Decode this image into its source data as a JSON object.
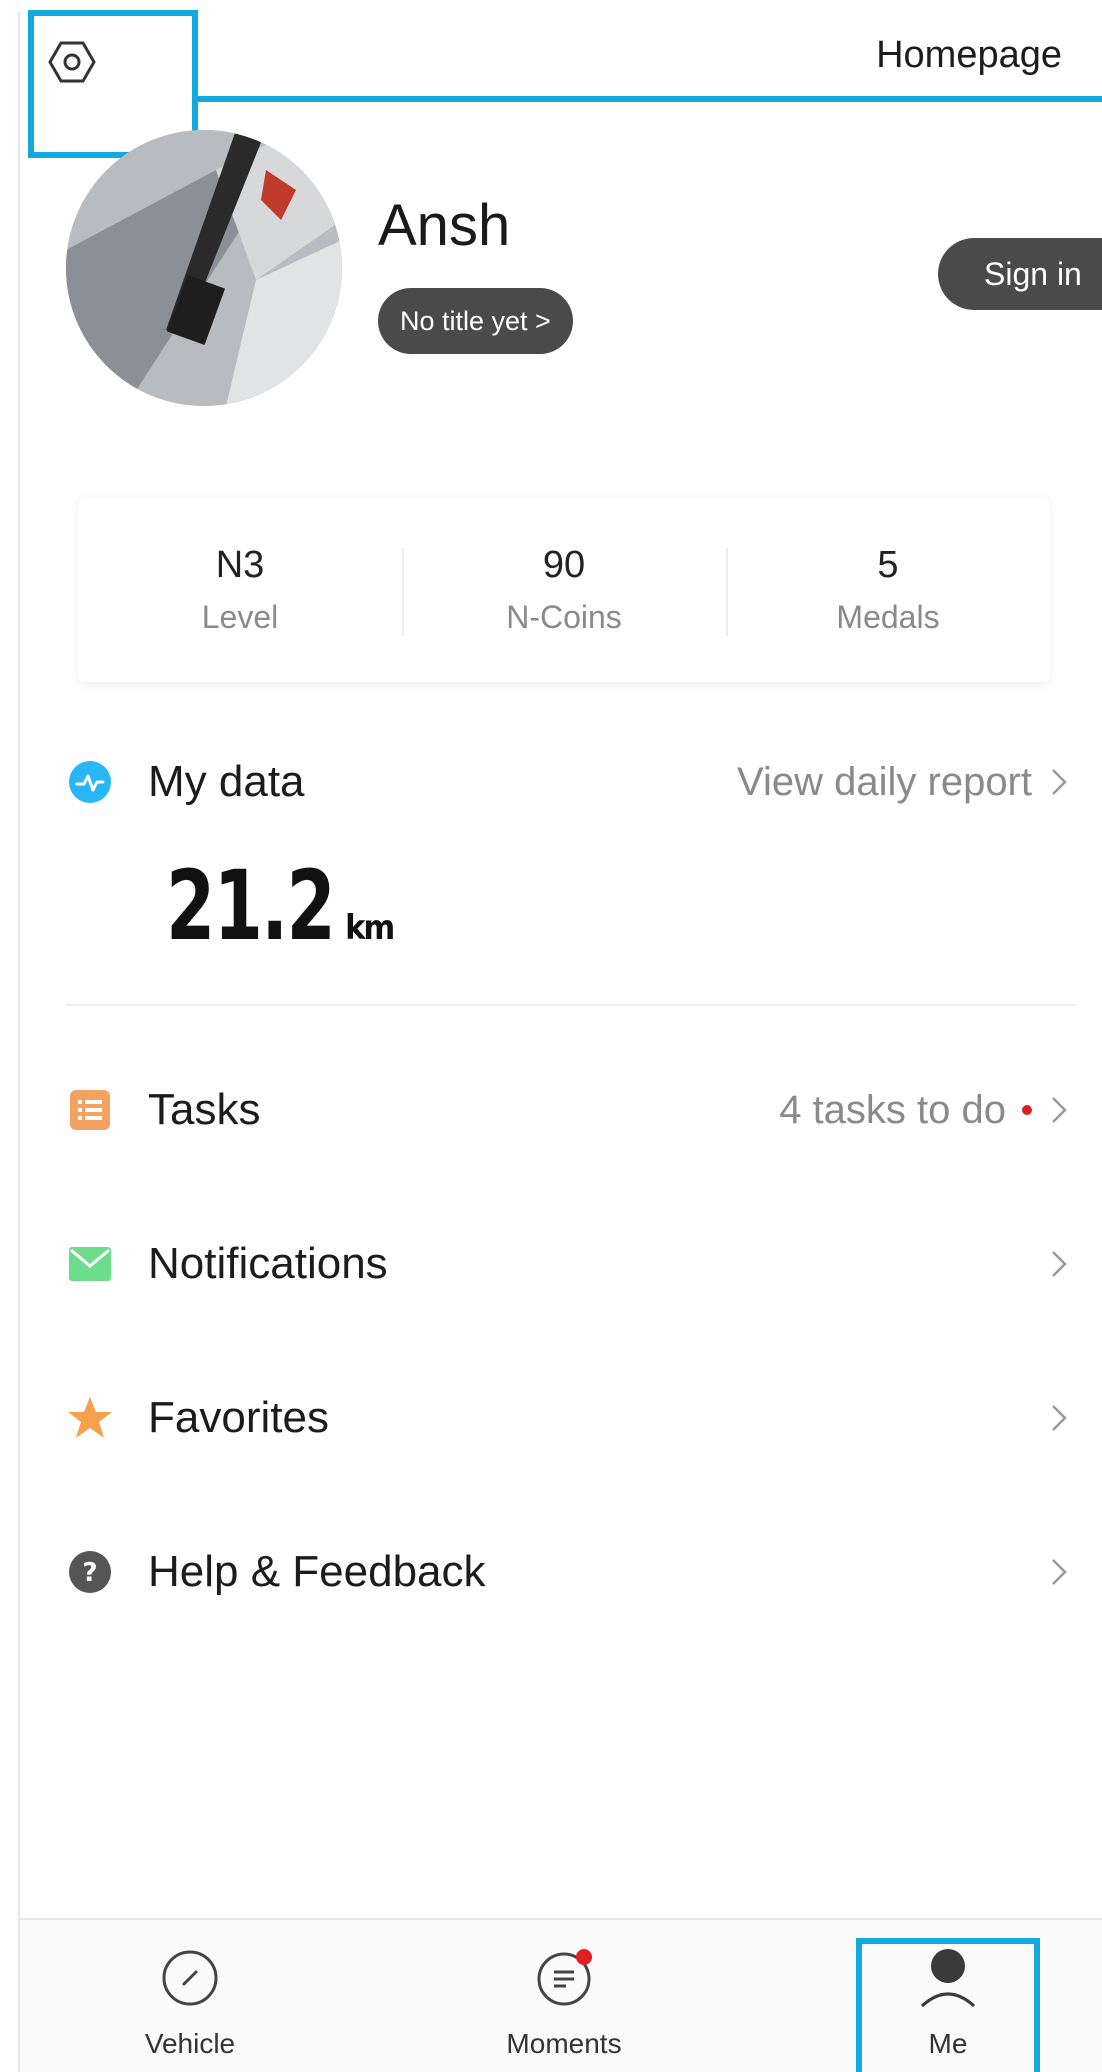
{
  "header": {
    "settings_icon": "gear-hexagon-icon",
    "homepage_label": "Homepage"
  },
  "profile": {
    "name": "Ansh",
    "title_chip": "No title yet >",
    "signin_label": "Sign in"
  },
  "stats": [
    {
      "value": "N3",
      "label": "Level"
    },
    {
      "value": "90",
      "label": "N-Coins"
    },
    {
      "value": "5",
      "label": "Medals"
    }
  ],
  "my_data": {
    "label": "My data",
    "link": "View daily report",
    "distance_value": "21.2",
    "distance_unit": "km",
    "icon_color": "#29b6f6"
  },
  "menu": {
    "tasks": {
      "label": "Tasks",
      "right": "4 tasks to do",
      "icon_color": "#f4a261"
    },
    "notifications": {
      "label": "Notifications",
      "icon_color": "#6ddc8b"
    },
    "favorites": {
      "label": "Favorites",
      "icon_color": "#f5a04a"
    },
    "help": {
      "label": "Help & Feedback",
      "icon_color": "#555555"
    }
  },
  "bottom_nav": [
    {
      "label": "Vehicle",
      "icon": "speedometer-icon"
    },
    {
      "label": "Moments",
      "icon": "chat-icon",
      "badge": true
    },
    {
      "label": "Me",
      "icon": "person-icon",
      "active": true
    }
  ],
  "colors": {
    "highlight": "#12a8e0",
    "chip_bg": "#4a4a4a",
    "badge": "#e02020"
  }
}
